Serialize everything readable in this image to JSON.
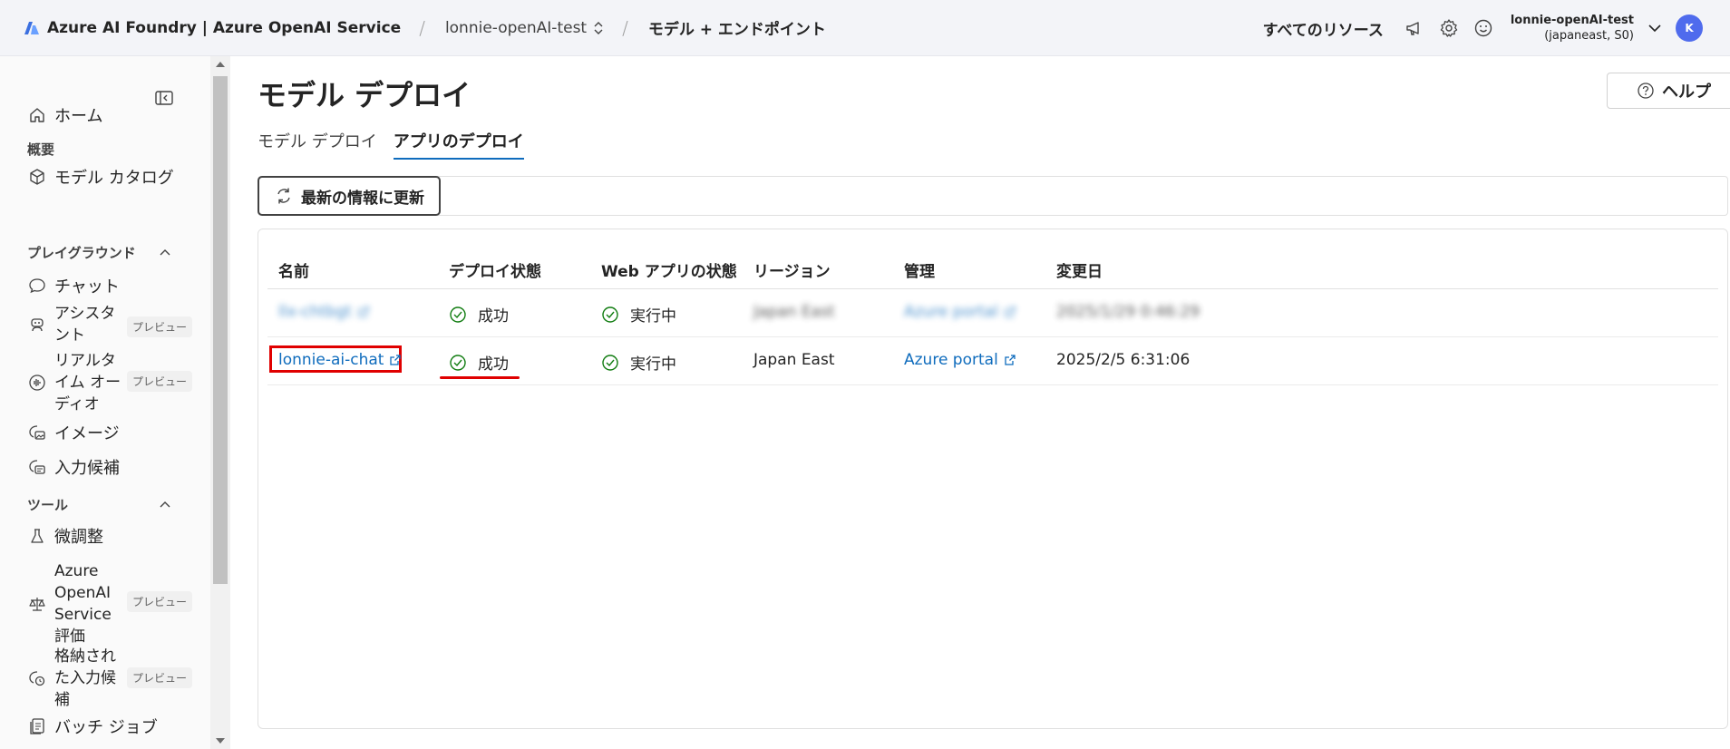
{
  "header": {
    "brand": "Azure AI Foundry | Azure OpenAI Service",
    "breadcrumb_project": "lonnie-openAI-test",
    "breadcrumb_page": "モデル + エンドポイント",
    "all_resources": "すべてのリソース",
    "account_name": "lonnie-openAI-test",
    "account_sub": "(japaneast, S0)",
    "avatar_initial": "K"
  },
  "sidebar": {
    "home": "ホーム",
    "section_overview": "概要",
    "model_catalog": "モデル カタログ",
    "section_playground": "プレイグラウンド",
    "chat": "チャット",
    "assistant": "アシスタント",
    "realtime_audio": "リアルタイム オーディオ",
    "images": "イメージ",
    "completions": "入力候補",
    "section_tools": "ツール",
    "finetune": "微調整",
    "evaluation": "Azure OpenAI Service 評価",
    "stored_completions": "格納された入力候補",
    "batch_jobs": "バッチ ジョブ",
    "preview_badge": "プレビュー"
  },
  "main": {
    "title": "モデル デプロイ",
    "help": "ヘルプ",
    "tabs": [
      "モデル デプロイ",
      "アプリのデプロイ"
    ],
    "refresh": "最新の情報に更新",
    "columns": [
      "名前",
      "デプロイ状態",
      "Web アプリの状態",
      "リージョン",
      "管理",
      "変更日"
    ],
    "rows": [
      {
        "name": "llx-chtbgt",
        "deploy_status": "成功",
        "app_status": "実行中",
        "region": "Japan East",
        "manage": "Azure portal",
        "modified": "2025/1/29 0:46:29"
      },
      {
        "name": "lonnie-ai-chat",
        "deploy_status": "成功",
        "app_status": "実行中",
        "region": "Japan East",
        "manage": "Azure portal",
        "modified": "2025/2/5 6:31:06"
      }
    ]
  },
  "colors": {
    "accent": "#0f6cbd",
    "success": "#107c10",
    "highlight": "#e00000",
    "avatar": "#4f6bed"
  },
  "icons": [
    "azure-ai-logo",
    "updown-icon",
    "megaphone-icon",
    "gear-icon",
    "smiley-icon",
    "chevron-down-icon",
    "collapse-panel-icon",
    "home-icon",
    "cube-icon",
    "chat-icon",
    "assistant-icon",
    "audio-icon",
    "image-icon",
    "completion-icon",
    "flask-icon",
    "scale-icon",
    "stored-icon",
    "batch-icon",
    "help-icon",
    "refresh-icon",
    "check-circle-icon",
    "external-link-icon"
  ]
}
